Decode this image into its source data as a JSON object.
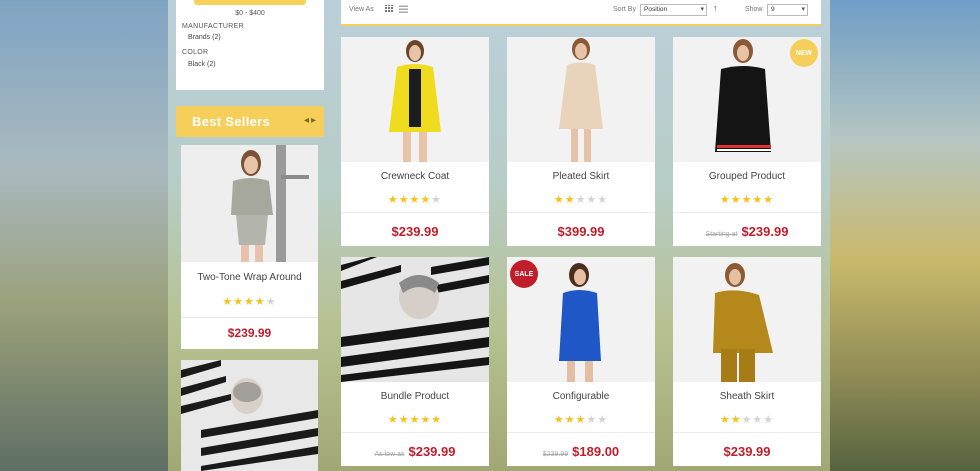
{
  "filters": {
    "price_range": "$0 - $400",
    "manufacturer_label": "MANUFACTURER",
    "manufacturer_value": "Brands (2)",
    "color_label": "COLOR",
    "color_value": "Black (2)"
  },
  "best_sellers": {
    "title": "Best Sellers",
    "prev_icon": "◂",
    "next_icon": "▸",
    "items": [
      {
        "name": "Two-Tone Wrap Around",
        "rating": 4,
        "price": "$239.99"
      }
    ]
  },
  "toolbar": {
    "view_as": "View As",
    "sort_by_label": "Sort By",
    "sort_value": "Position",
    "sort_dir_icon": "↑",
    "show_label": "Show",
    "show_value": "9"
  },
  "products": [
    {
      "name": "Crewneck Coat",
      "rating": 4,
      "old_price": "",
      "price": "$239.99",
      "badge": ""
    },
    {
      "name": "Pleated Skirt",
      "rating": 2,
      "old_price": "",
      "price": "$399.99",
      "badge": ""
    },
    {
      "name": "Grouped Product",
      "rating": 5,
      "old_price": "Starting at",
      "price": "$239.99",
      "badge": "NEW"
    },
    {
      "name": "Bundle Product",
      "rating": 5,
      "old_price": "As low as",
      "price": "$239.99",
      "badge": ""
    },
    {
      "name": "Configurable",
      "rating": 3,
      "old_price": "$239.99",
      "price": "$189.00",
      "badge": "SALE"
    },
    {
      "name": "Sheath Skirt",
      "rating": 2,
      "old_price": "",
      "price": "$239.99",
      "badge": ""
    }
  ],
  "colors": {
    "accent": "#f6cf5a",
    "price": "#c11e2c",
    "sale_badge": "#c11e2c",
    "new_badge": "#f6cf5a"
  }
}
